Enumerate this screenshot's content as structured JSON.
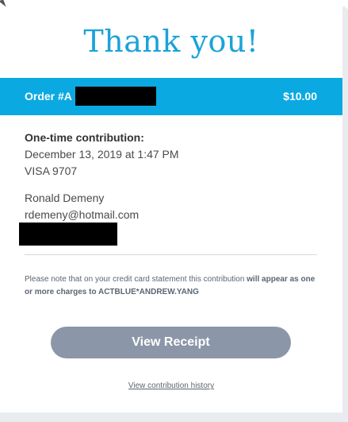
{
  "header": {
    "title": "Thank you!"
  },
  "order": {
    "label": "Order #A",
    "amount": "$10.00"
  },
  "contribution": {
    "kind": "One-time contribution:",
    "date": "December 13, 2019 at 1:47 PM",
    "card": "VISA 9707"
  },
  "donor": {
    "name": "Ronald Demeny",
    "email": "rdemeny@hotmail.com"
  },
  "notice": {
    "text_a": "Please note that on your credit card statement this contribution ",
    "text_b": "will appear as one or more charges to ACTBLUE*ANDREW.YANG"
  },
  "actions": {
    "view_receipt": "View Receipt",
    "history_link": "View contribution history"
  },
  "colors": {
    "accent": "#0aa9e2",
    "title": "#1aa3d9",
    "button": "#8b97a8"
  }
}
